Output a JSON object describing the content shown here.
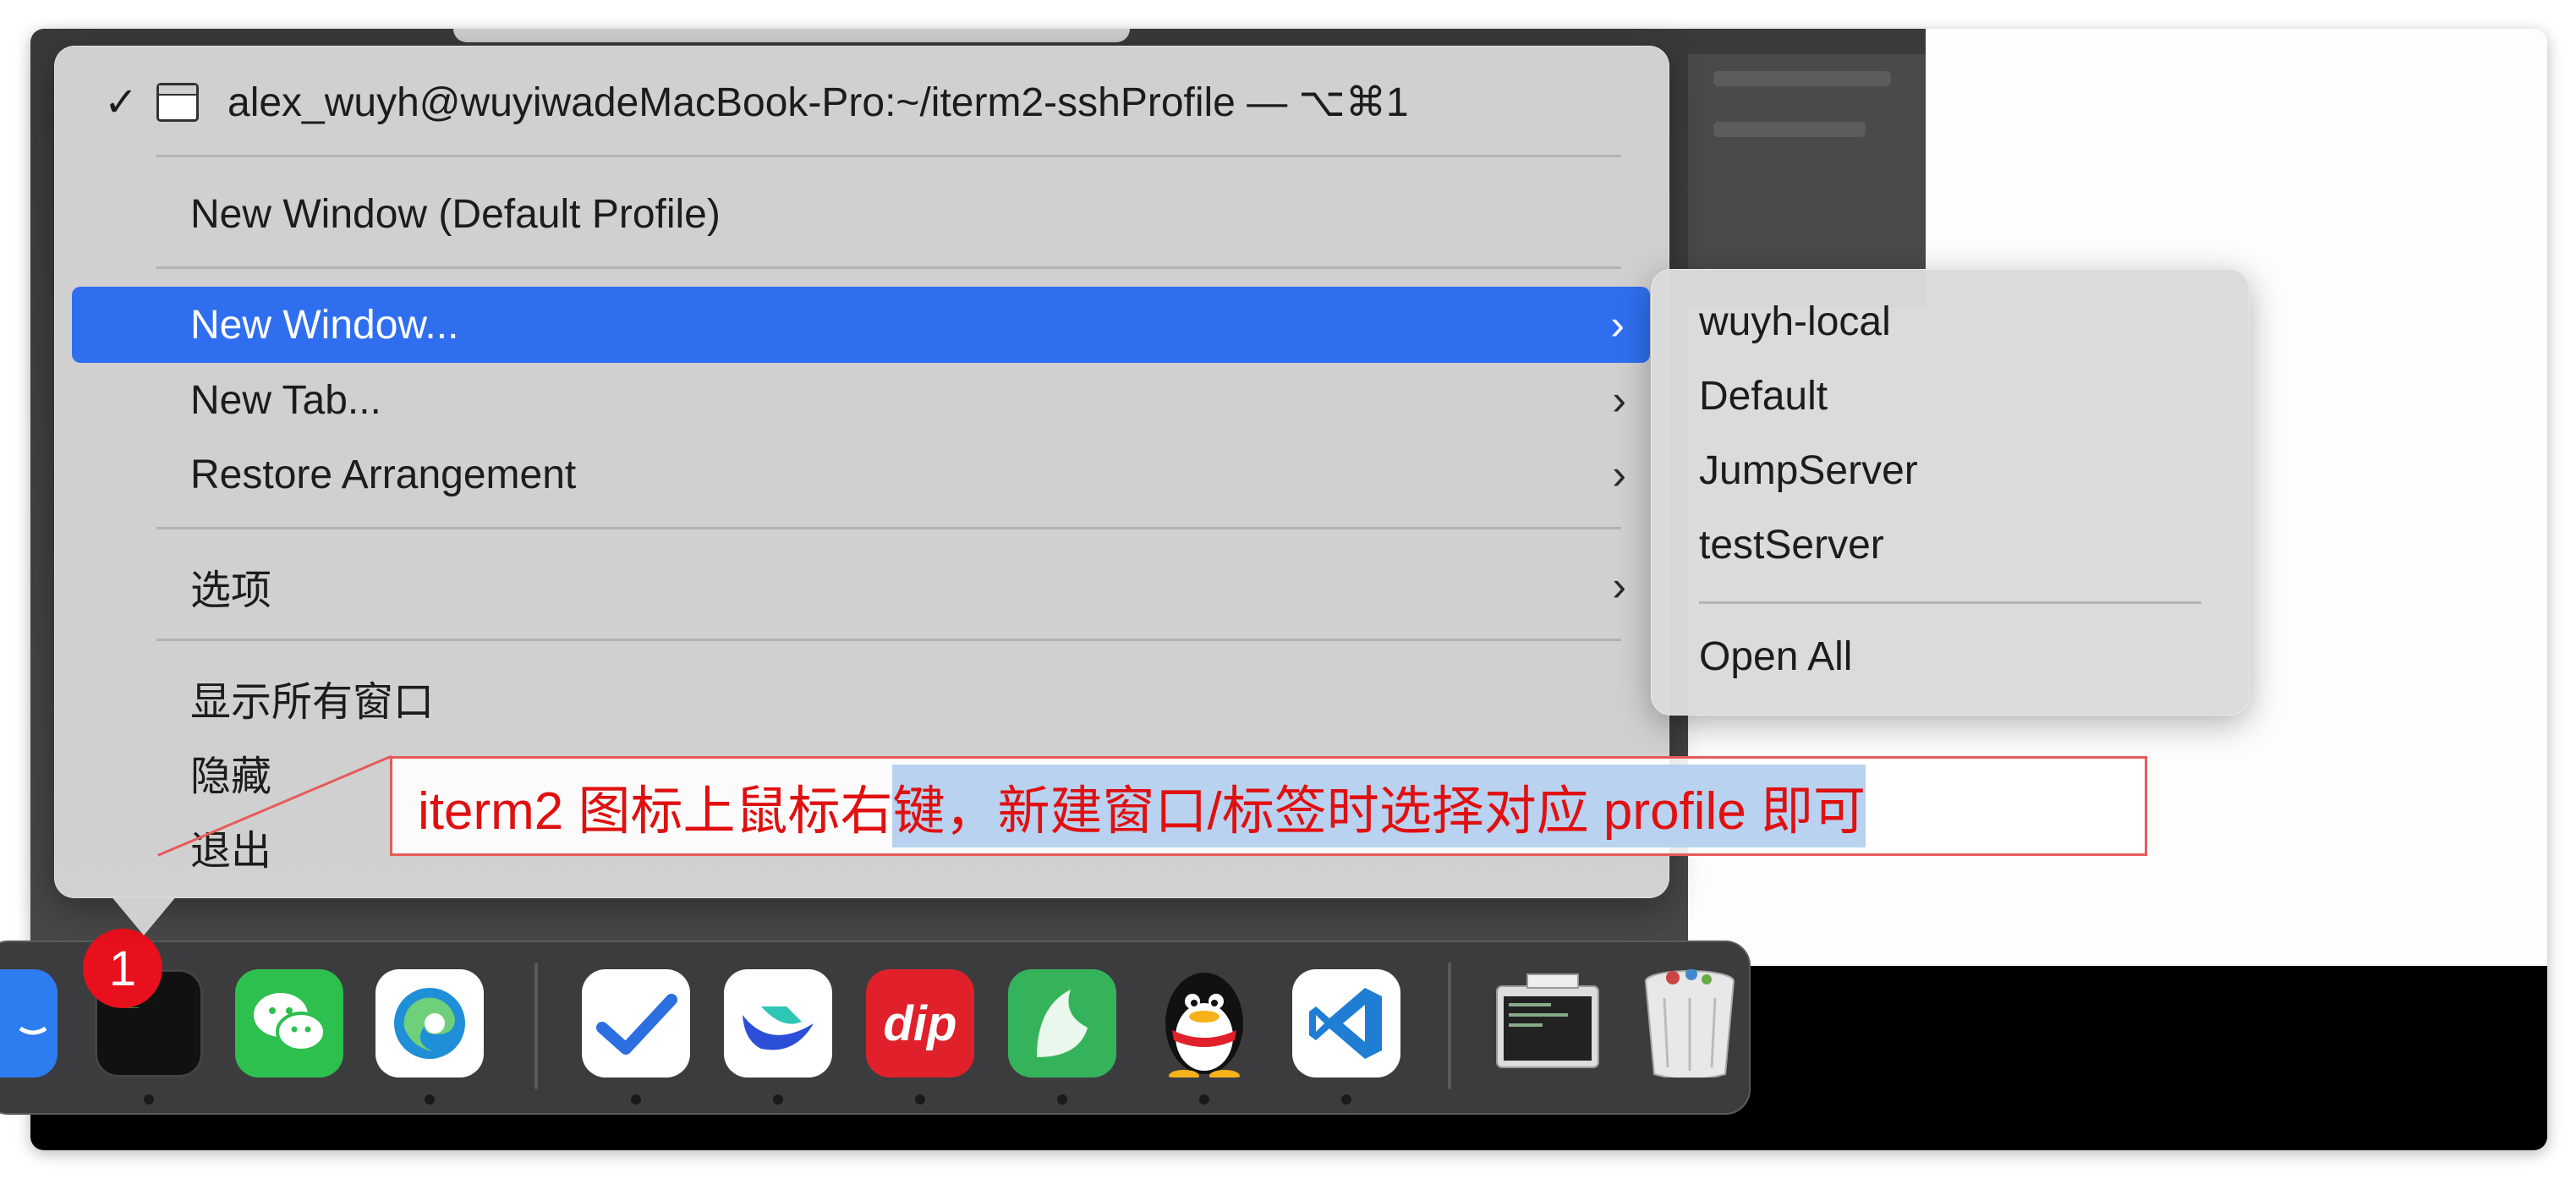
{
  "menu": {
    "current_window": "alex_wuyh@wuyiwadeMacBook-Pro:~/iterm2-sshProfile — ⌥⌘1",
    "check": "✓",
    "items": [
      {
        "label": "New Window (Default Profile)"
      },
      {
        "label": "New Window...",
        "submenu": true,
        "selected": true
      },
      {
        "label": "New Tab...",
        "submenu": true
      },
      {
        "label": "Restore Arrangement",
        "submenu": true
      },
      {
        "label": "选项",
        "submenu": true
      },
      {
        "label": "显示所有窗口"
      },
      {
        "label": "隐藏"
      },
      {
        "label": "退出"
      }
    ],
    "chevron": "›"
  },
  "submenu": {
    "profiles": [
      "wuyh-local",
      "Default",
      "JumpServer",
      "testServer"
    ],
    "open_all": "Open All"
  },
  "annotation": {
    "text_plain": "iterm2 图标上鼠标右",
    "text_highlighted": "键，新建窗口/标签时选择对应 profile 即可",
    "color": "#e01010"
  },
  "dock": {
    "badge": "1",
    "iterm_prompt": "$_",
    "apps": [
      "finder-icon",
      "iterm2-icon",
      "wechat-icon",
      "edge-icon",
      "todo-icon",
      "feishu-icon",
      "dip-icon",
      "yuque-icon",
      "qq-icon",
      "vscode-icon",
      "preview-icon",
      "trash-icon"
    ]
  },
  "colors": {
    "selection": "#2f6fef",
    "badge": "#e8101c",
    "highlight": "#b8d2f0"
  }
}
